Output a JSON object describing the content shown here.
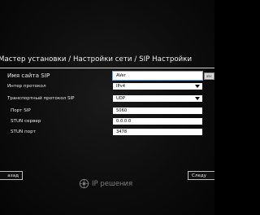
{
  "header": {
    "title": "Мастер установки / Настройки сети / SIP Настройки"
  },
  "form": {
    "site_name": {
      "label": "Имя сайта SIP",
      "value": "AVer"
    },
    "internet_protocol": {
      "label": "Интер протокол",
      "value": "IPv4"
    },
    "transport_protocol": {
      "label": "Транспортный протокол SIP",
      "value": "UDP"
    },
    "sip_port": {
      "label": "Порт SIP",
      "value": "5060"
    },
    "stun_server": {
      "label": "STUN сервер",
      "value": "0.0.0.0"
    },
    "stun_port": {
      "label": "STUN порт",
      "value": "3478"
    }
  },
  "keyboard_hint": {
    "label": "abc"
  },
  "footer": {
    "back_label": "азад",
    "next_label": "Следу"
  },
  "watermark": {
    "text": "IP решения",
    "icon": "ip-logo-icon"
  },
  "colors": {
    "background": "#0c0c0c",
    "text": "#f0f0f0",
    "field": "#ffffff",
    "focus_outline": "#7fa6c8"
  }
}
